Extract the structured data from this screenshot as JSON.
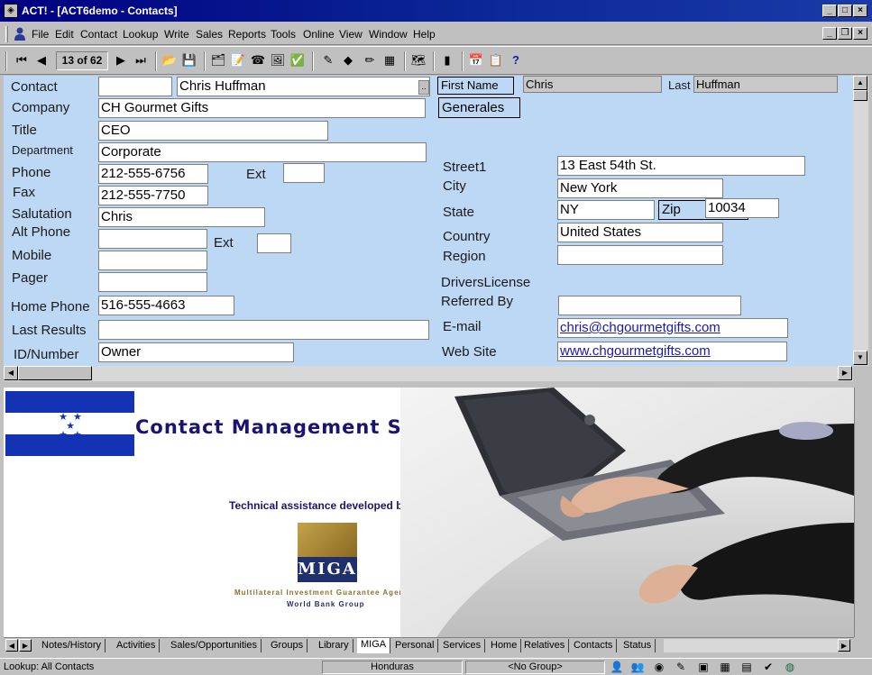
{
  "window": {
    "title": "ACT! - [ACT6demo - Contacts]"
  },
  "menu": [
    "File",
    "Edit",
    "Contact",
    "Lookup",
    "Write",
    "Sales",
    "Reports",
    "Tools",
    "Online",
    "View",
    "Window",
    "Help"
  ],
  "toolbar": {
    "record_counter": "13 of 62"
  },
  "form": {
    "labels": {
      "contact": "Contact",
      "company": "Company",
      "title": "Title",
      "department": "Department",
      "phone": "Phone",
      "ext": "Ext",
      "fax": "Fax",
      "salutation": "Salutation",
      "alt_phone": "Alt Phone",
      "alt_ext": "Ext",
      "mobile": "Mobile",
      "pager": "Pager",
      "home_phone": "Home Phone",
      "last_results": "Last Results",
      "id_number": "ID/Number",
      "first_name": "First Name",
      "last": "Last",
      "street1": "Street1",
      "city": "City",
      "state": "State",
      "zip": "Zip",
      "country": "Country",
      "region": "Region",
      "drivers_license": "DriversLicense",
      "referred_by": "Referred By",
      "email": "E-mail",
      "web_site": "Web Site"
    },
    "values": {
      "contact": "Chris Huffman",
      "company": "CH Gourmet Gifts",
      "title": "CEO",
      "department": "Corporate",
      "phone": "212-555-6756",
      "fax": "212-555-7750",
      "salutation": "Chris",
      "home_phone": "516-555-4663",
      "id_number": "Owner",
      "first_name": "Chris",
      "last": "Huffman",
      "group": "Generales",
      "street1": "13 East 54th St.",
      "city": "New York",
      "state": "NY",
      "zip": "10034",
      "country": "United States",
      "email": "chris@chgourmetgifts.com",
      "web_site": "www.chgourmetgifts.com"
    }
  },
  "banner": {
    "title": "Contact Management System",
    "tech_assist": "Technical assistance developed by",
    "logo_text": "MIGA",
    "logo_sub1": "Multilateral Investment Guarantee Agency",
    "logo_sub2": "World Bank Group"
  },
  "tabs": [
    "Notes/History",
    "Activities",
    "Sales/Opportunities",
    "Groups",
    "Library",
    "MIGA",
    "Personal",
    "Services",
    "Home",
    "Relatives",
    "Contacts",
    "Status"
  ],
  "active_tab": "MIGA",
  "status": {
    "lookup": "Lookup: All Contacts",
    "group_filter": "Honduras",
    "no_group": "<No Group>"
  },
  "colors": {
    "form_bg": "#bcd8f4",
    "title_bar": "#000080",
    "banner_navy": "#1a1470",
    "flag_blue": "#1432b4"
  }
}
